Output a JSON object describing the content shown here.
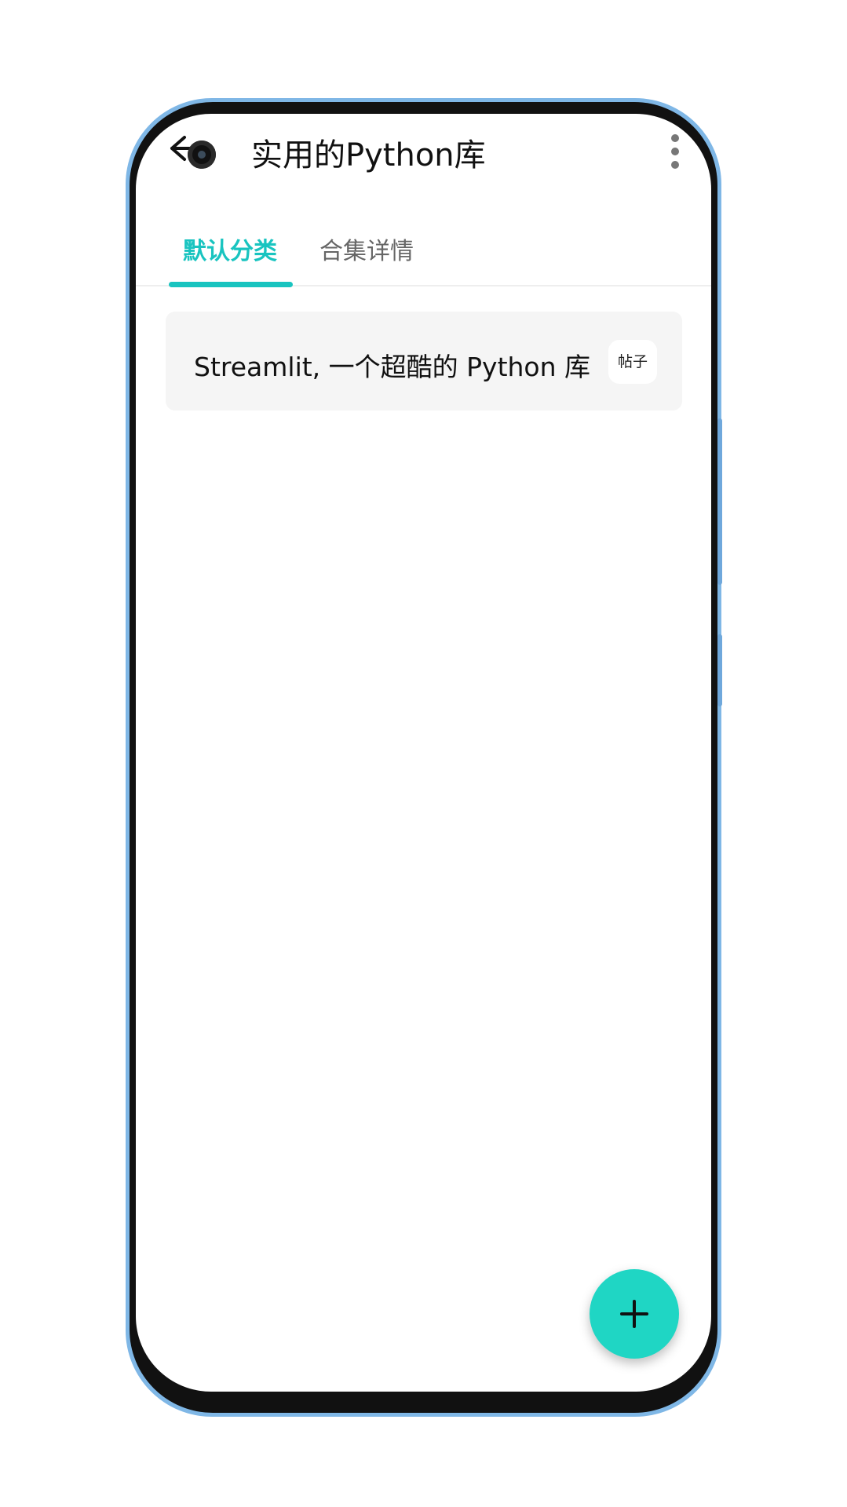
{
  "app_bar": {
    "title": "实用的Python库",
    "back_icon": "arrow-left-icon",
    "more_icon": "more-vertical-icon"
  },
  "tabs": [
    {
      "label": "默认分类",
      "active": true
    },
    {
      "label": "合集详情",
      "active": false
    }
  ],
  "list": {
    "items": [
      {
        "title": "Streamlit, 一个超酷的 Python 库",
        "badge": "帖子"
      }
    ]
  },
  "fab": {
    "icon": "plus-icon"
  },
  "colors": {
    "accent": "#19c4c0",
    "fab": "#1fd6c4",
    "card_bg": "#f5f5f5",
    "frame_edge": "#7fb7e6",
    "frame_body": "#111111"
  }
}
